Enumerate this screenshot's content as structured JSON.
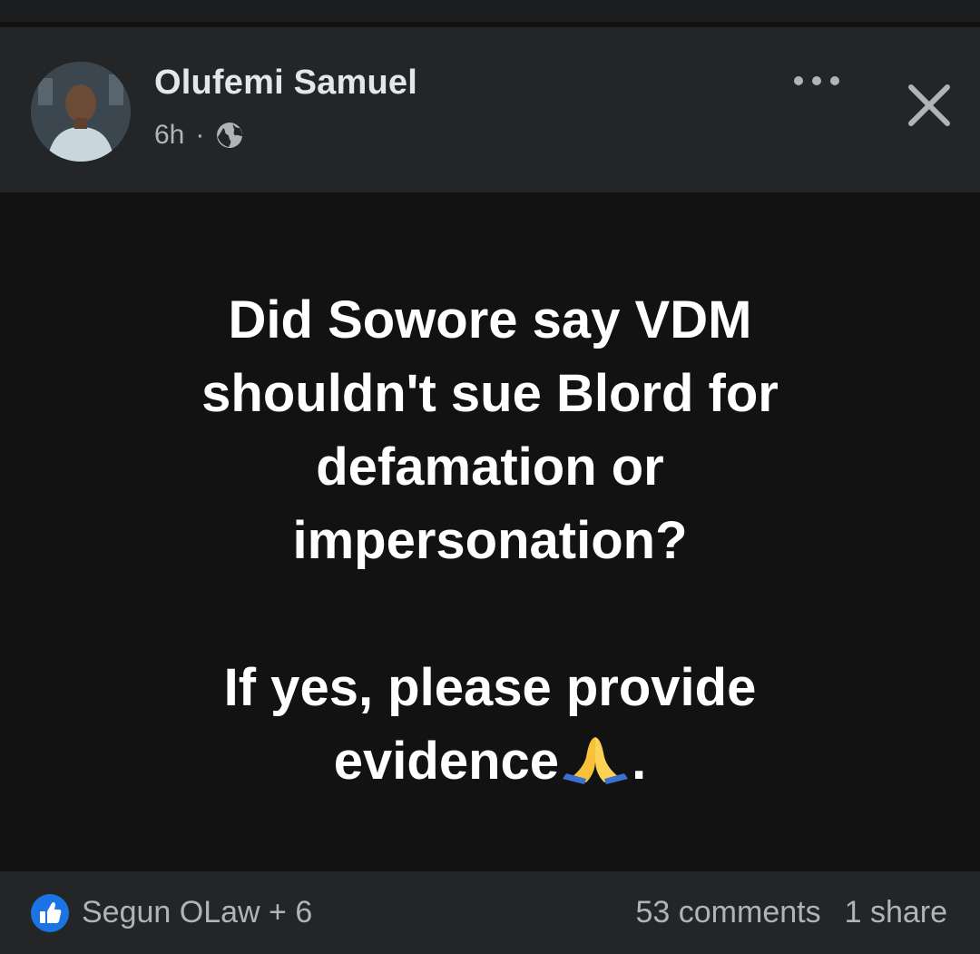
{
  "post": {
    "author_name": "Olufemi Samuel",
    "timestamp": "6h",
    "separator": "·",
    "privacy_icon": "globe-icon",
    "body_lines": [
      "Did Sowore say VDM",
      "shouldn't sue Blord for",
      "defamation or",
      "impersonation?"
    ],
    "body_line_2a": "If yes, please provide",
    "body_line_2b_text": "evidence",
    "body_line_2b_emoji": "🙏",
    "body_line_2b_end": "."
  },
  "footer": {
    "reaction_icon": "like-icon",
    "reactors": "Segun OLaw + 6",
    "comments": "53 comments",
    "shares": "1 share"
  },
  "controls": {
    "more_icon": "more-options-icon",
    "close_icon": "close-icon"
  },
  "colors": {
    "header_bg": "#242526",
    "body_bg": "#121212",
    "like_blue": "#1b74e4",
    "secondary_text": "#b0b3b8"
  }
}
